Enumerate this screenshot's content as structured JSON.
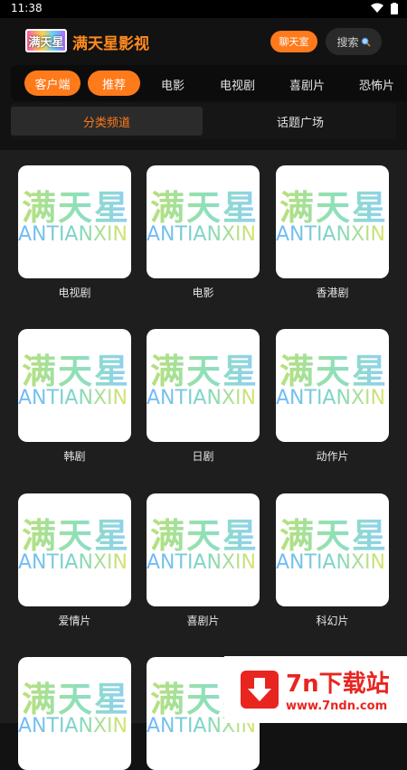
{
  "status_bar": {
    "time": "11:38"
  },
  "header": {
    "logo_text": "满天星",
    "title": "满天星影视",
    "chat_label": "聊天室",
    "search_label": "搜索"
  },
  "nav": {
    "client_label": "客户端",
    "tabs": [
      "推荐",
      "电影",
      "电视剧",
      "喜剧片",
      "恐怖片"
    ],
    "active_tab": "推荐"
  },
  "segments": {
    "active": "分类频道",
    "inactive": "话题广场"
  },
  "thumbnail": {
    "cn": "满天星",
    "en": "ANTIANXIN"
  },
  "categories": [
    "电视剧",
    "电影",
    "香港剧",
    "韩剧",
    "日剧",
    "动作片",
    "爱情片",
    "喜剧片",
    "科幻片"
  ],
  "watermark": {
    "title": "7n下载站",
    "url": "www.7ndn.com"
  },
  "colors": {
    "accent": "#ff7a1a",
    "background": "#121212",
    "grid_bg": "#1e1e1e"
  }
}
